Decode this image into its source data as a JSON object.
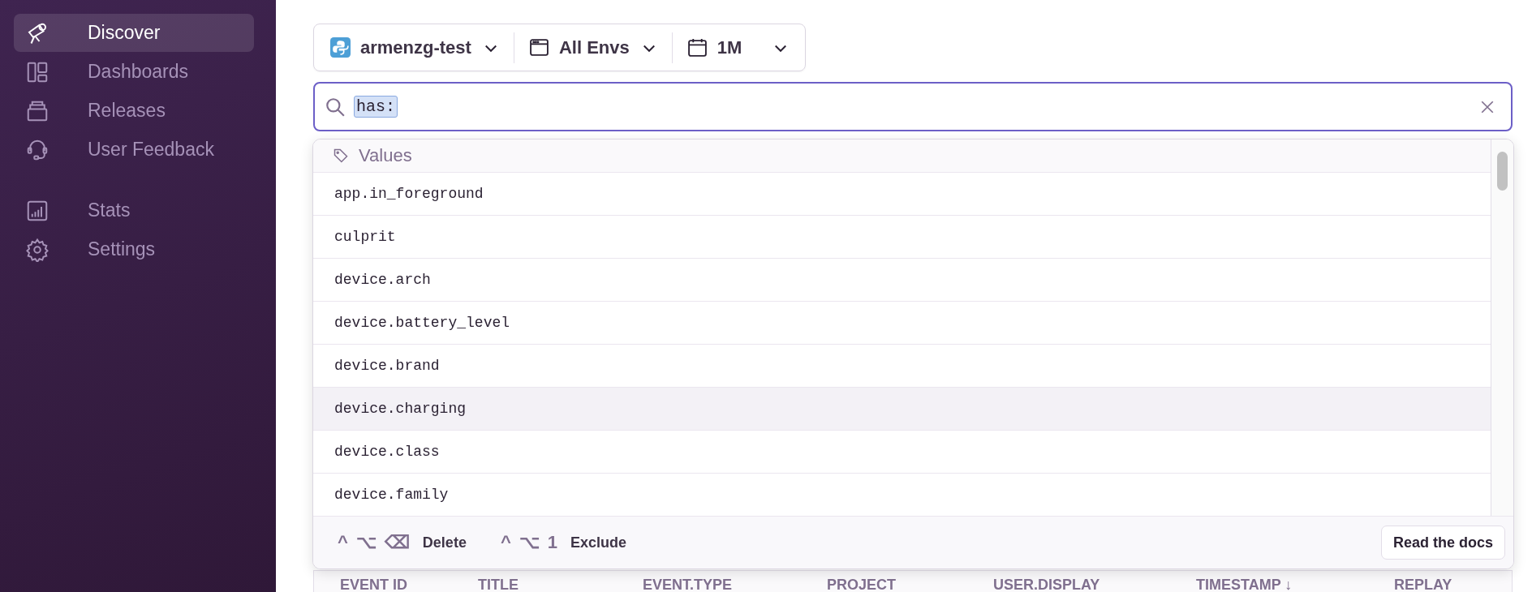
{
  "sidebar": {
    "sections": [
      {
        "items": [
          {
            "label": "Discover",
            "selected": true
          },
          {
            "label": "Dashboards",
            "selected": false
          },
          {
            "label": "Releases",
            "selected": false
          },
          {
            "label": "User Feedback",
            "selected": false
          }
        ]
      },
      {
        "items": [
          {
            "label": "Stats",
            "selected": false
          },
          {
            "label": "Settings",
            "selected": false
          }
        ]
      }
    ]
  },
  "filters": [
    {
      "label": "armenzg-test"
    },
    {
      "label": "All Envs"
    },
    {
      "label": "1M"
    }
  ],
  "search": {
    "value": "has:"
  },
  "dropdown": {
    "section": "Values",
    "items": [
      {
        "label": "app.in_foreground",
        "selected": false
      },
      {
        "label": "culprit",
        "selected": false
      },
      {
        "label": "device.arch",
        "selected": false
      },
      {
        "label": "device.battery_level",
        "selected": false
      },
      {
        "label": "device.brand",
        "selected": false
      },
      {
        "label": "device.charging",
        "selected": true
      },
      {
        "label": "device.class",
        "selected": false
      },
      {
        "label": "device.family",
        "selected": false
      }
    ],
    "hints": [
      {
        "keys": [
          "^",
          "⌥",
          "⌫"
        ],
        "label": "Delete"
      },
      {
        "keys": [
          "^",
          "⌥",
          "1"
        ],
        "label": "Exclude"
      }
    ],
    "docs_button": "Read the docs"
  },
  "table": {
    "columns": [
      "EVENT ID",
      "TITLE",
      "EVENT.TYPE",
      "PROJECT",
      "USER.DISPLAY",
      "TIMESTAMP ↓",
      "REPLAY"
    ]
  }
}
